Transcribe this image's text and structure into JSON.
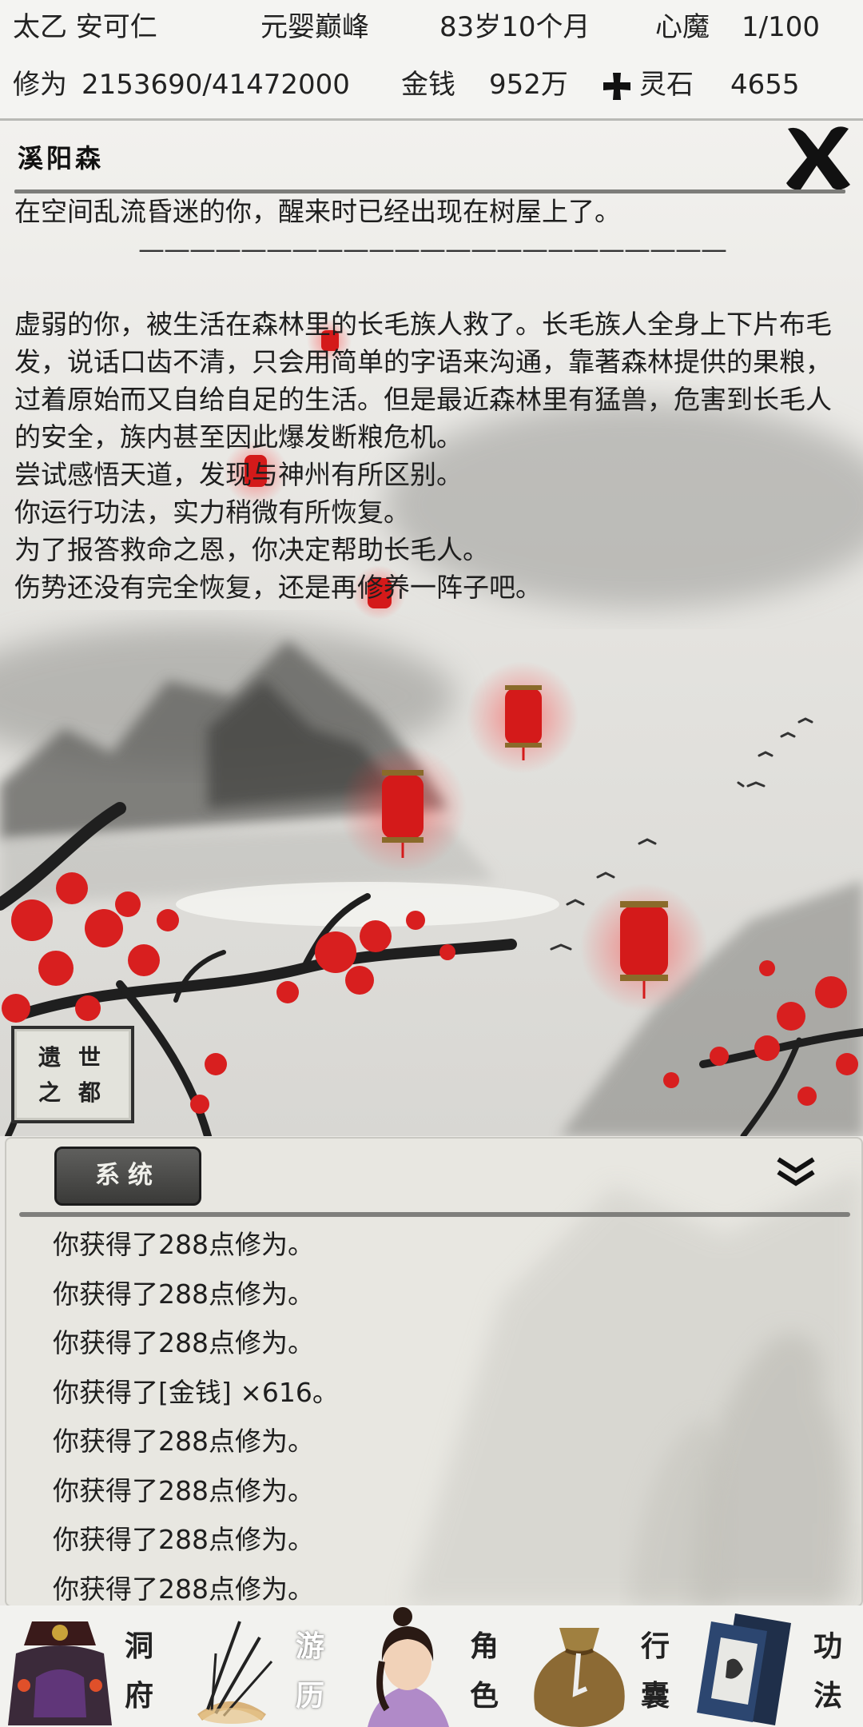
{
  "status_bar": {
    "name": "太乙 安可仁",
    "realm": "元婴巅峰",
    "age": "83岁10个月",
    "demon_label": "心魔",
    "demon_value": "1/100",
    "cultivation_label": "修为",
    "cultivation_value": "2153690/41472000",
    "money_label": "金钱",
    "money_value": "952万",
    "stone_label": "灵石",
    "stone_value": "4655"
  },
  "location": {
    "name": "溪阳森"
  },
  "story": {
    "intro": "在空间乱流昏迷的你，醒来时已经出现在树屋上了。",
    "divider": "———————————————————————",
    "paragraph": "虚弱的你，被生活在森林里的长毛族人救了。长毛族人全身上下片布毛发，说话口齿不清，只会用简单的字语来沟通，靠著森林提供的果粮，过着原始而又自给自足的生活。但是最近森林里有猛兽，危害到长毛人的安全，族内甚至因此爆发断粮危机。",
    "lines": [
      "尝试感悟天道，发现与神州有所区别。",
      "你运行功法，实力稍微有所恢复。",
      "为了报答救命之恩，你决定帮助长毛人。",
      "伤势还没有完全恢复，还是再修养一阵子吧。"
    ]
  },
  "seal": {
    "c1": "世",
    "c2": "遗",
    "c3": "都",
    "c4": "之"
  },
  "log": {
    "tab": "系统",
    "entries": [
      "你获得了288点修为。",
      "你获得了288点修为。",
      "你获得了288点修为。",
      "你获得了[金钱] ×616。",
      "你获得了288点修为。",
      "你获得了288点修为。",
      "你获得了288点修为。",
      "你获得了288点修为。"
    ]
  },
  "nav": [
    {
      "c1": "洞",
      "c2": "府",
      "icon": "cave-dwelling-icon"
    },
    {
      "c1": "游",
      "c2": "历",
      "icon": "travel-icon"
    },
    {
      "c1": "角",
      "c2": "色",
      "icon": "character-icon"
    },
    {
      "c1": "行",
      "c2": "囊",
      "icon": "bag-icon"
    },
    {
      "c1": "功",
      "c2": "法",
      "icon": "scroll-icon"
    }
  ],
  "colors": {
    "lantern": "#d41a1a",
    "blossom": "#d81f1f",
    "ink": "#3a3a3a",
    "nav_active": "#ffffff"
  }
}
